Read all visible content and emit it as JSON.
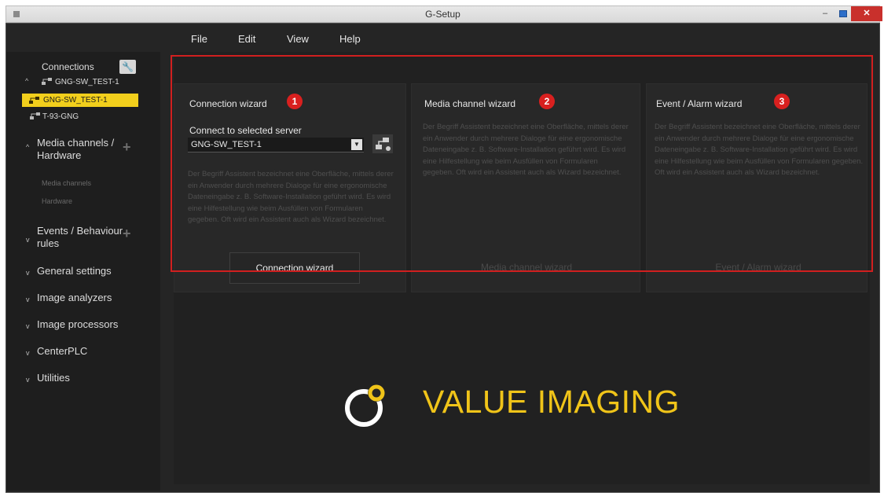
{
  "window": {
    "title": "G-Setup"
  },
  "menu": {
    "items": [
      "File",
      "Edit",
      "View",
      "Help"
    ]
  },
  "sidebar": {
    "connections_label": "Connections",
    "servers": [
      {
        "label": "GNG-SW_TEST-1"
      },
      {
        "label": "GNG-SW_TEST-1"
      },
      {
        "label": "T-93-GNG"
      }
    ],
    "sections": [
      {
        "label_line1": "Media channels /",
        "label_line2": "Hardware",
        "sub_items": [
          "Media channels",
          "Hardware"
        ]
      },
      {
        "label_line1": "Events / Behaviour",
        "label_line2": "rules"
      },
      {
        "label": "General settings"
      },
      {
        "label": "Image analyzers"
      },
      {
        "label": "Image processors"
      },
      {
        "label": "CenterPLC"
      },
      {
        "label": "Utilities"
      }
    ]
  },
  "wizards": [
    {
      "title": "Connection wizard",
      "badge": "1",
      "connect_label": "Connect to selected server",
      "server_value": "GNG-SW_TEST-1",
      "description": "Der Begriff Assistent bezeichnet eine Oberfläche, mittels derer ein Anwender durch mehrere Dialoge für eine ergonomische Dateneingabe z. B. Software-Installation geführt wird. Es wird eine Hilfestellung wie beim Ausfüllen von Formularen gegeben. Oft wird ein Assistent auch als Wizard bezeichnet.",
      "button_label": "Connection wizard"
    },
    {
      "title": "Media channel wizard",
      "badge": "2",
      "description": "Der Begriff Assistent bezeichnet eine Oberfläche, mittels derer ein Anwender durch mehrere Dialoge für eine ergonomische Dateneingabe z. B. Software-Installation geführt wird. Es wird eine Hilfestellung wie beim Ausfüllen von Formularen gegeben. Oft wird ein Assistent auch als Wizard bezeichnet.",
      "button_label": "Media channel wizard"
    },
    {
      "title": "Event / Alarm wizard",
      "badge": "3",
      "description": "Der Begriff Assistent bezeichnet eine Oberfläche, mittels derer ein Anwender durch mehrere Dialoge für eine ergonomische Dateneingabe z. B. Software-Installation geführt wird. Es wird eine Hilfestellung wie beim Ausfüllen von Formularen gegeben. Oft wird ein Assistent auch als Wizard bezeichnet.",
      "button_label": "Event / Alarm wizard"
    }
  ],
  "logo": {
    "text": "VALUE IMAGING"
  },
  "colors": {
    "accent": "#f0c419",
    "highlight": "#d11f1f",
    "background": "#252525"
  }
}
